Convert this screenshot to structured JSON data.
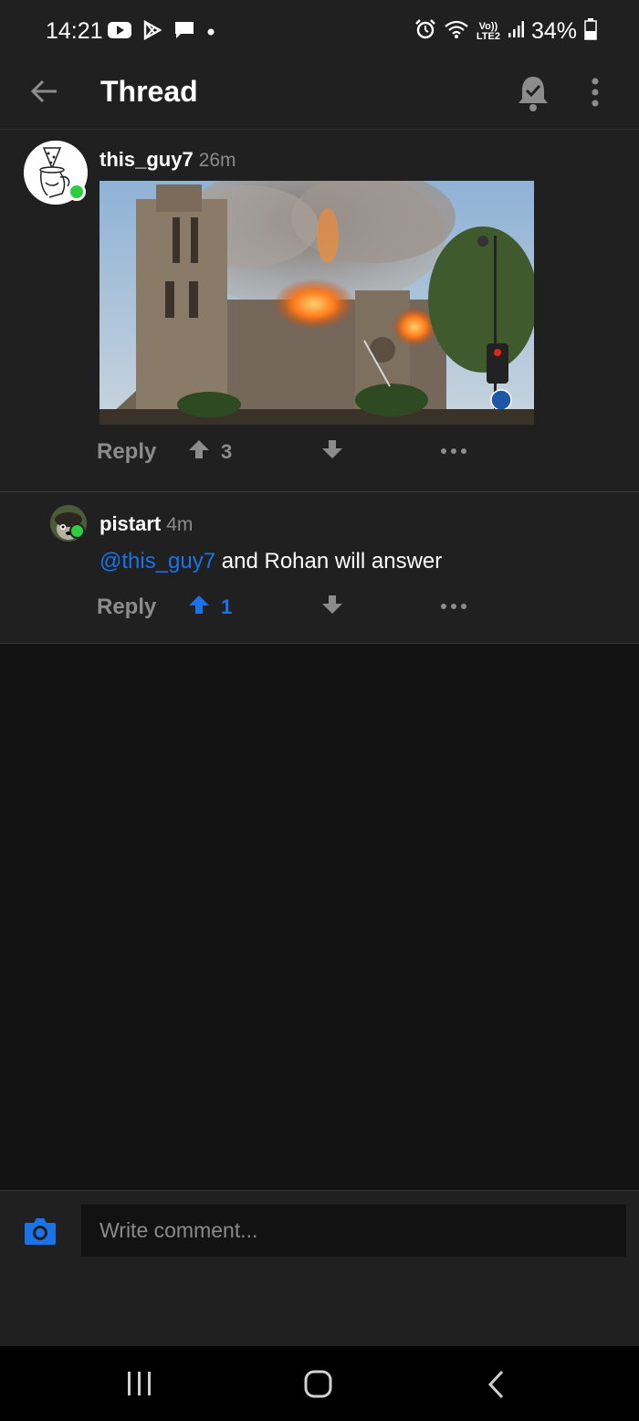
{
  "status_bar": {
    "time": "14:21",
    "battery": "34%",
    "notification_icons": [
      "youtube-icon",
      "play-store-icon",
      "message-icon",
      "dot-icon"
    ],
    "system_icons": [
      "alarm-icon",
      "wifi-icon",
      "volte-lte2-icon",
      "signal-icon",
      "battery-icon"
    ],
    "lte_text_top": "Vo))",
    "lte_text_bottom": "LTE2"
  },
  "app_bar": {
    "title": "Thread",
    "icons": [
      "back-arrow-icon",
      "bell-check-icon",
      "more-vert-icon"
    ]
  },
  "comments": [
    {
      "username": "this_guy7",
      "time": "26m",
      "image_alt": "notre-dame-fire-photo",
      "reply_label": "Reply",
      "upvotes": "3",
      "upvoted": false
    },
    {
      "username": "pistart",
      "time": "4m",
      "mention": "@this_guy7",
      "text": " and Rohan will answer",
      "reply_label": "Reply",
      "upvotes": "1",
      "upvoted": true
    }
  ],
  "composer": {
    "placeholder": "Write comment...",
    "icon": "camera-icon"
  },
  "colors": {
    "accent": "#1a73e8",
    "online": "#2ecc40",
    "surface": "#202020",
    "background": "#121212"
  }
}
